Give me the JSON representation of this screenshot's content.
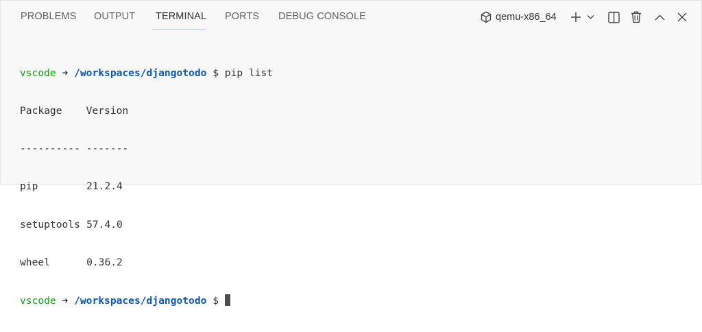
{
  "tabs": [
    {
      "label": "PROBLEMS"
    },
    {
      "label": "OUTPUT"
    },
    {
      "label": "TERMINAL",
      "active": true
    },
    {
      "label": "PORTS"
    },
    {
      "label": "DEBUG CONSOLE"
    }
  ],
  "terminal_shell": {
    "label": "qemu-x86_64",
    "icon": "cube-icon"
  },
  "toolbar_icons": [
    "plus-icon",
    "chevron-down-icon",
    "split-icon",
    "trash-icon",
    "chevron-up-icon",
    "close-icon"
  ],
  "colors": {
    "user": "#12a112",
    "path": "#0b56b8",
    "active_tab_underline": "#f0a9a0"
  },
  "terminal": {
    "prompt_user": "vscode",
    "prompt_arrow": "➜",
    "prompt_path": "/workspaces/djangotodo",
    "prompt_symbol": "$",
    "command": "pip list",
    "header_package": "Package",
    "header_version": "Version",
    "separator": "---------- -------",
    "packages": [
      {
        "name": "pip",
        "version": "21.2.4"
      },
      {
        "name": "setuptools",
        "version": "57.4.0"
      },
      {
        "name": "wheel",
        "version": "0.36.2"
      }
    ]
  }
}
